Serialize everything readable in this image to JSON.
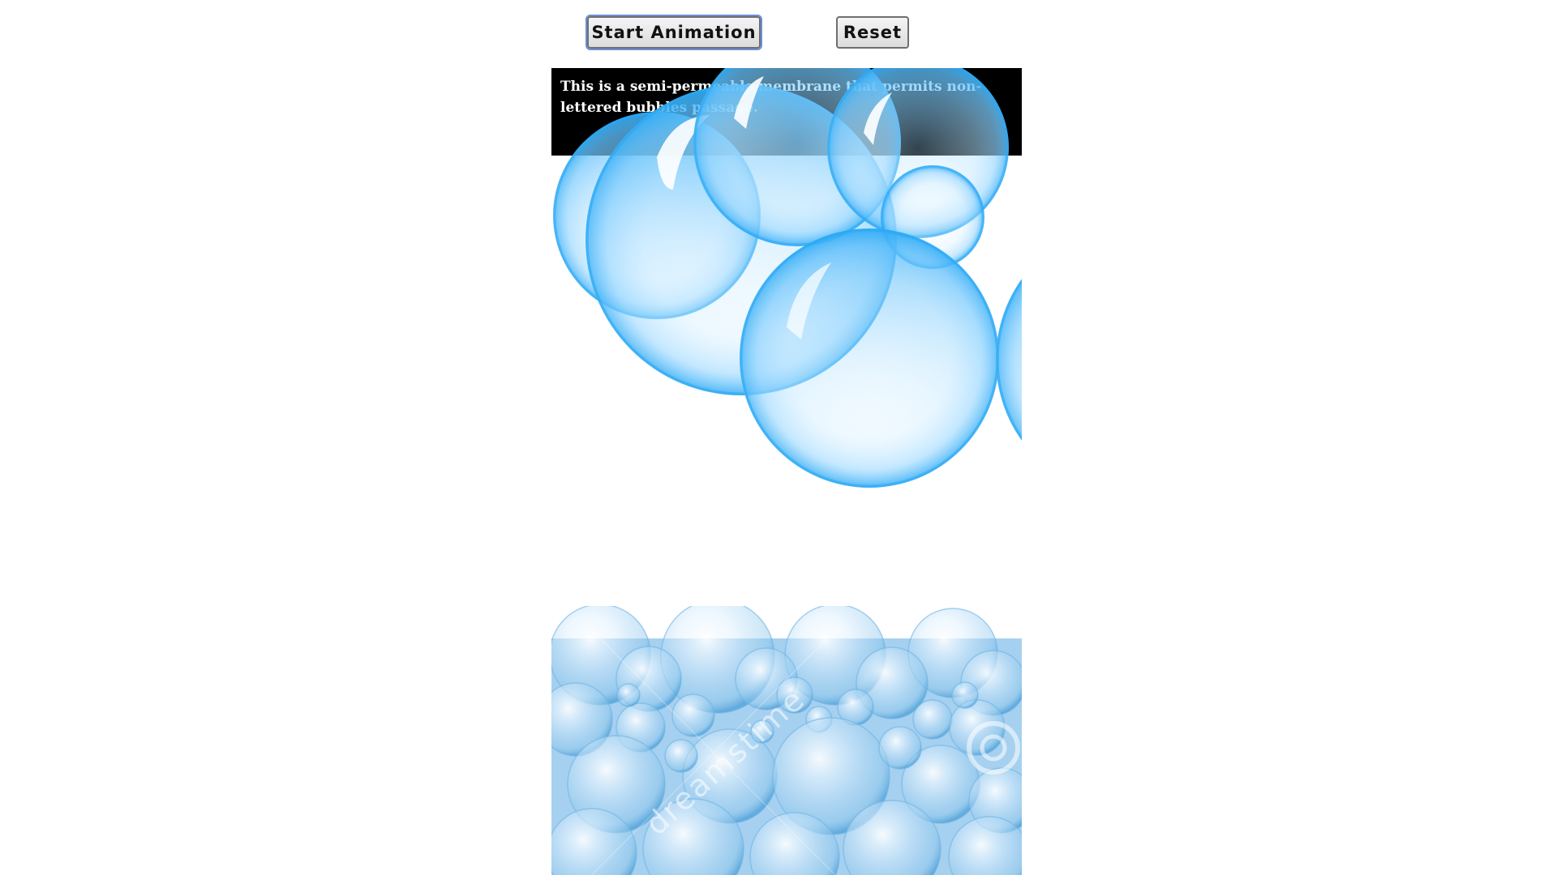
{
  "controls": {
    "start_label": "Start Animation",
    "reset_label": "Reset"
  },
  "membrane": {
    "text": "This is a semi-permeable membrane that permits non-lettered bubbles passage."
  },
  "bubble_floor": {
    "watermark": "dreamstime"
  },
  "colors": {
    "membrane": "#000000",
    "bubble_edge": "#2aa9f5",
    "bubble_fill": "#bfe5ff",
    "floor": "#a8d2f0"
  }
}
